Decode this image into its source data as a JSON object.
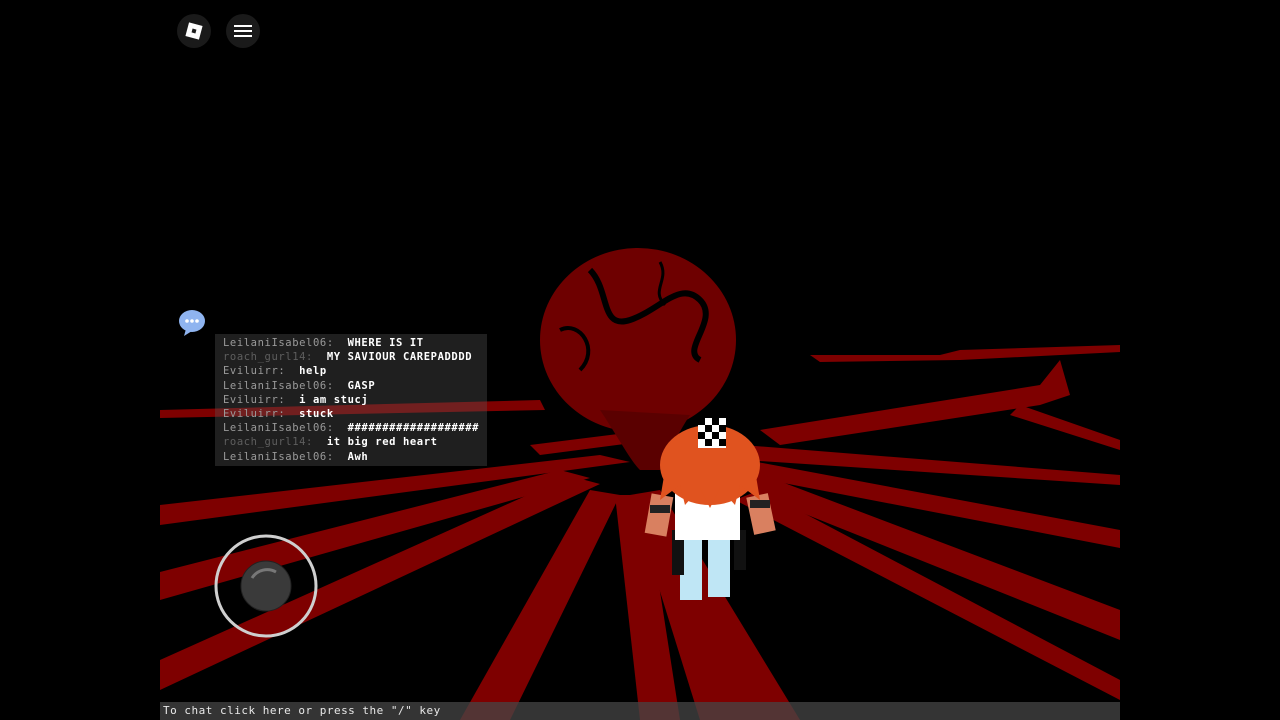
{
  "topbar": {
    "roblox_button_icon": "roblox-logo-icon",
    "menu_button_icon": "hamburger-menu-icon"
  },
  "chat": {
    "toggle_icon": "chat-bubble-icon",
    "messages": [
      {
        "name": "LeilaniIsabel06:",
        "text": "WHERE IS IT"
      },
      {
        "name": "roach_gurl14:",
        "text": "MY SAVIOUR CAREPADDDD"
      },
      {
        "name": "Eviluirr:",
        "text": "help"
      },
      {
        "name": "LeilaniIsabel06:",
        "text": "GASP"
      },
      {
        "name": "Eviluirr:",
        "text": "i am stucj"
      },
      {
        "name": "Eviluirr:",
        "text": "stuck"
      },
      {
        "name": "LeilaniIsabel06:",
        "text": "###################"
      },
      {
        "name": "roach_gurl14:",
        "text": "it big red heart"
      },
      {
        "name": "LeilaniIsabel06:",
        "text": "Awh"
      }
    ],
    "input_hint": "To chat click here or press the \"/\" key"
  },
  "controls": {
    "thumbstick_icon": "thumbstick-icon"
  },
  "colors": {
    "background": "#000000",
    "heart_red": "#7a0000",
    "floor_red": "#8b0000",
    "hair_orange": "#e0531f"
  }
}
